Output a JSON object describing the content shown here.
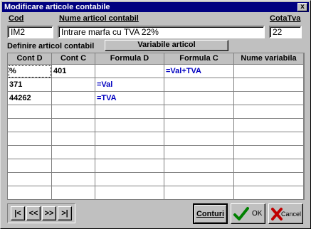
{
  "window": {
    "title": "Modificare articole contabile",
    "close": "x"
  },
  "fields": {
    "cod_label": "Cod",
    "cod_value": "IM2",
    "nume_label": "Nume articol contabil",
    "nume_value": "Intrare marfa cu TVA 22%",
    "cota_label": "CotaTva",
    "cota_value": "22"
  },
  "tabs": {
    "definire": "Definire articol contabil",
    "variabile": "Variabile articol"
  },
  "grid": {
    "headers": [
      "Cont D",
      "Cont C",
      "Formula D",
      "Formula C",
      "Nume variabila"
    ],
    "rows": [
      [
        "%",
        "401",
        "",
        "=Val+TVA",
        ""
      ],
      [
        "371",
        "",
        "=Val",
        "",
        ""
      ],
      [
        "44262",
        "",
        "=TVA",
        "",
        ""
      ],
      [
        "",
        "",
        "",
        "",
        ""
      ],
      [
        "",
        "",
        "",
        "",
        ""
      ],
      [
        "",
        "",
        "",
        "",
        ""
      ],
      [
        "",
        "",
        "",
        "",
        ""
      ],
      [
        "",
        "",
        "",
        "",
        ""
      ],
      [
        "",
        "",
        "",
        "",
        ""
      ],
      [
        "",
        "",
        "",
        "",
        ""
      ]
    ]
  },
  "nav": {
    "first": "|<",
    "prev": "<<",
    "next": ">>",
    "last": ">|"
  },
  "buttons": {
    "conturi": "Conturi",
    "ok": "OK",
    "cancel": "Cancel"
  },
  "colors": {
    "title_bg": "#000080",
    "formula_text": "#0000c0",
    "ok_check": "#008000",
    "cancel_x": "#c00000"
  }
}
